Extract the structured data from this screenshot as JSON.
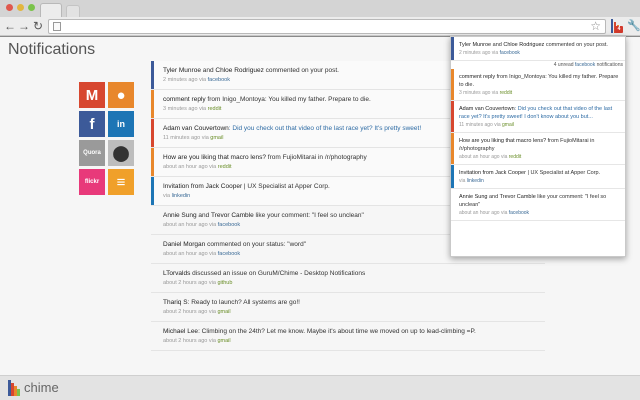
{
  "browser": {
    "extension_badge": "4",
    "colors": {
      "red": "#e0584d",
      "yellow": "#e2b63f",
      "green": "#7ac34a"
    }
  },
  "page": {
    "title": "Notifications"
  },
  "social_services": [
    {
      "name": "gmail",
      "label": "M",
      "icon": "gmail-icon",
      "color": "#d7472f",
      "fg": "#ffffff"
    },
    {
      "name": "reddit",
      "label": "●",
      "icon": "reddit-icon",
      "color": "#e8872c",
      "fg": "#ffffff"
    },
    {
      "name": "facebook",
      "label": "f",
      "icon": "facebook-icon",
      "color": "#3c5a99",
      "fg": "#ffffff"
    },
    {
      "name": "linkedin",
      "label": "in",
      "icon": "linkedin-icon",
      "color": "#1d75b5",
      "fg": "#ffffff"
    },
    {
      "name": "quora",
      "label": "Quora",
      "icon": "quora-icon",
      "color": "#9a9a9a",
      "fg": "#ffffff"
    },
    {
      "name": "github",
      "label": "⬤",
      "icon": "github-icon",
      "color": "#bdbdbd",
      "fg": "#333333"
    },
    {
      "name": "flickr",
      "label": "flickr",
      "icon": "flickr-icon",
      "color": "#e8397a",
      "fg": "#ffffff"
    },
    {
      "name": "stackoverflow",
      "label": "≡",
      "icon": "stackoverflow-icon",
      "color": "#f0a02a",
      "fg": "#ffffff"
    }
  ],
  "feed": [
    {
      "pre": "Tyler Munroe",
      "mid": " and ",
      "pre2": "Chloe Rodriguez",
      "rest": " commented on your post.",
      "time": "2 minutes ago via ",
      "source": "facebook",
      "bar": "#3c5a99"
    },
    {
      "pre": "comment reply",
      "rest": " from Inigo_Montoya: You killed my father. Prepare to die.",
      "time": "3 minutes ago via ",
      "source": "reddit",
      "bar": "#e8872c"
    },
    {
      "pre": "Adam van Couvertown",
      "rest": ": Did you check out that video of the last race yet? It's pretty sweet!",
      "time": "11 minutes ago via ",
      "source": "gmail",
      "bar": "#d7472f",
      "blue_rest": true
    },
    {
      "pre": "How are you liking that macro lens?",
      "rest": " from FujioMitarai in /r/photography",
      "time": "about an hour ago via ",
      "source": "reddit",
      "bar": "#e8872c"
    },
    {
      "pre": "Invitation from Jack Cooper",
      "rest": " | UX Specialist at Apper Corp.",
      "time": "via ",
      "source": "linkedin",
      "bar": "#1d75b5"
    },
    {
      "pre": "Annie Sung",
      "mid": " and ",
      "pre2": "Trevor Camble",
      "rest": " like your comment: \"I feel so unclean\"",
      "time": "about an hour ago via ",
      "source": "facebook",
      "bar": ""
    },
    {
      "pre": "Daniel Morgan",
      "rest": " commented on your status: \"word\"",
      "time": "about an hour ago via ",
      "source": "facebook",
      "bar": ""
    },
    {
      "pre": "LTorvalds",
      "rest": " discussed an issue on GuruM/Chime - Desktop Notifications",
      "time": "about 2 hours ago via ",
      "source": "github",
      "bar": ""
    },
    {
      "pre": "Thariq S",
      "rest": ": Ready to launch? All systems are go!!",
      "time": "about 2 hours ago via ",
      "source": "gmail",
      "bar": ""
    },
    {
      "pre": "Michael Lee",
      "rest": ": Climbing on the 24th? Let me know. Maybe it's about time we moved on up to lead-climbing =P.",
      "time": "about 2 hours ago via ",
      "source": "gmail",
      "bar": ""
    }
  ],
  "popup": {
    "unread_count": "4",
    "unread_source": "facebook",
    "unread_suffix": " notifications",
    "items": [
      {
        "pre": "Tyler Munroe",
        "mid": " and ",
        "pre2": "Chloe Rodriguez",
        "rest": " commented on your post.",
        "time": "2 minutes ago via ",
        "source": "facebook",
        "bar": "#3c5a99"
      },
      {
        "pre": "comment reply",
        "rest": " from Inigo_Montoya: You killed my father. Prepare to die.",
        "time": "3 minutes ago via ",
        "source": "reddit",
        "bar": "#e8872c"
      },
      {
        "pre": "Adam van Couvertown",
        "rest": ": Did you check out that video of the last race yet? It's pretty sweet! I don't know about you but...",
        "time": "11 minutes ago via ",
        "source": "gmail",
        "bar": "#d7472f",
        "blue_rest": true
      },
      {
        "pre": "How are you liking that macro lens?",
        "rest": " from FujioMitarai in /r/photography",
        "time": "about an hour ago via ",
        "source": "reddit",
        "bar": "#e8872c"
      },
      {
        "pre": "Invitation from Jack Cooper",
        "rest": " | UX Specialist at Apper Corp.",
        "time": "via ",
        "source": "linkedin",
        "bar": "#1d75b5"
      },
      {
        "pre": "Annie Sung",
        "mid": " and ",
        "pre2": "Trevor Camble",
        "rest": " like your comment: \"I feel so unclean\"",
        "time": "about an hour ago via ",
        "source": "facebook",
        "bar": ""
      }
    ]
  },
  "footer": {
    "logo": "chime",
    "logo_colors": [
      "#3c5a99",
      "#d7472f",
      "#e8872c",
      "#7ac34a"
    ]
  }
}
